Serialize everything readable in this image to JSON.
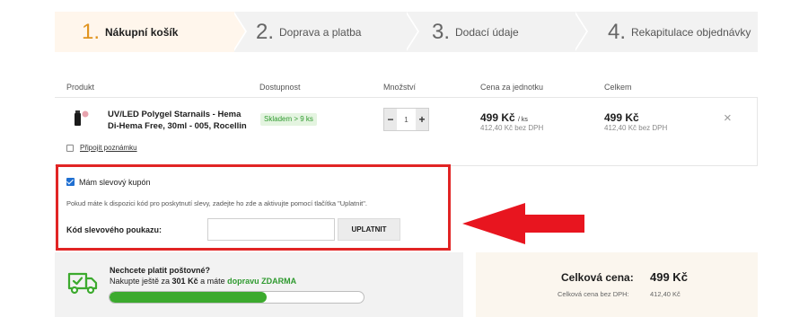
{
  "steps": [
    {
      "num": "1.",
      "label": "Nákupní košík",
      "active": true
    },
    {
      "num": "2.",
      "label": "Doprava a platba",
      "active": false
    },
    {
      "num": "3.",
      "label": "Dodací údaje",
      "active": false
    },
    {
      "num": "4.",
      "label": "Rekapitulace objednávky",
      "active": false
    }
  ],
  "table": {
    "headers": {
      "product": "Produkt",
      "availability": "Dostupnost",
      "quantity": "Množství",
      "unit_price": "Cena za jednotku",
      "total": "Celkem"
    }
  },
  "item": {
    "name": "UV/LED Polygel Starnails - Hema Di-Hema Free, 30ml - 005, Rocellin",
    "stock": "Skladem > 9 ks",
    "qty": "1",
    "qty_minus": "−",
    "qty_plus": "+",
    "unit_price": "499 Kč",
    "unit_suffix": "/ ks",
    "unit_price_no_vat": "412,40 Kč bez DPH",
    "total_price": "499 Kč",
    "total_price_no_vat": "412,40 Kč bez DPH",
    "remove_icon": "×",
    "note_label": "Připojit poznámku"
  },
  "coupon": {
    "checkbox_label": "Mám slevový kupón",
    "info": "Pokud máte k dispozici kód pro poskytnutí slevy, zadejte ho zde a aktivujte pomocí tlačítka \"Uplatnit\".",
    "code_label": "Kód slevového poukazu:",
    "code_value": "",
    "apply_button": "UPLATNIT"
  },
  "shipping": {
    "title": "Nechcete platit poštovné?",
    "text_before": "Nakupte ještě za ",
    "amount": "301 Kč",
    "text_middle": " a máte ",
    "free_text": "dopravu ZDARMA",
    "progress": 0.62
  },
  "totals": {
    "label": "Celková cena:",
    "value": "499 Kč",
    "no_vat_label": "Celková cena bez DPH:",
    "no_vat_value": "412,40 Kč"
  },
  "colors": {
    "accent": "#e0931d",
    "highlight_border": "#e12424",
    "arrow": "#e8151f",
    "green": "#3caa2e",
    "checkbox": "#1f6fd1"
  }
}
